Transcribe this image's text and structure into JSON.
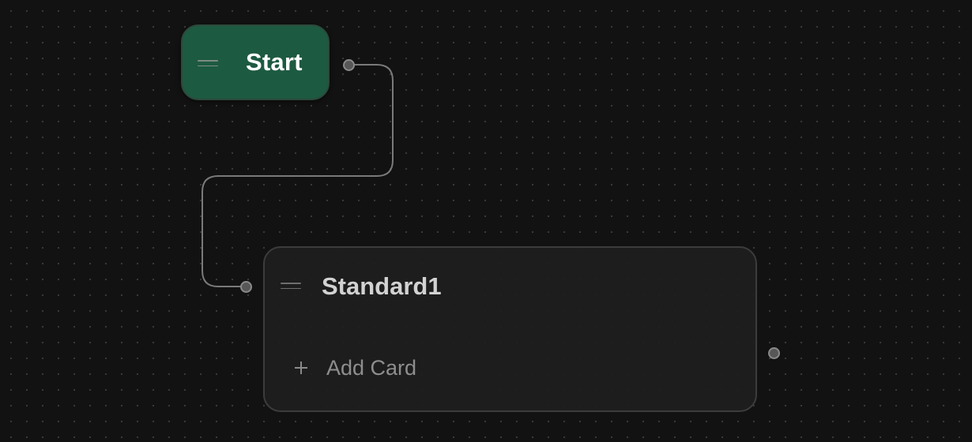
{
  "start_node": {
    "title": "Start",
    "handle_icon": "drag-handle-icon"
  },
  "standard_node": {
    "title": "Standard1",
    "handle_icon": "drag-handle-icon",
    "add_card": {
      "icon": "plus-icon",
      "label": "Add Card"
    }
  },
  "colors": {
    "canvas_background": "#121212",
    "start_node_fill": "#1d5a42",
    "standard_node_fill": "#1e1e1e",
    "edge": "#7a7a7a",
    "port": "#575757"
  }
}
